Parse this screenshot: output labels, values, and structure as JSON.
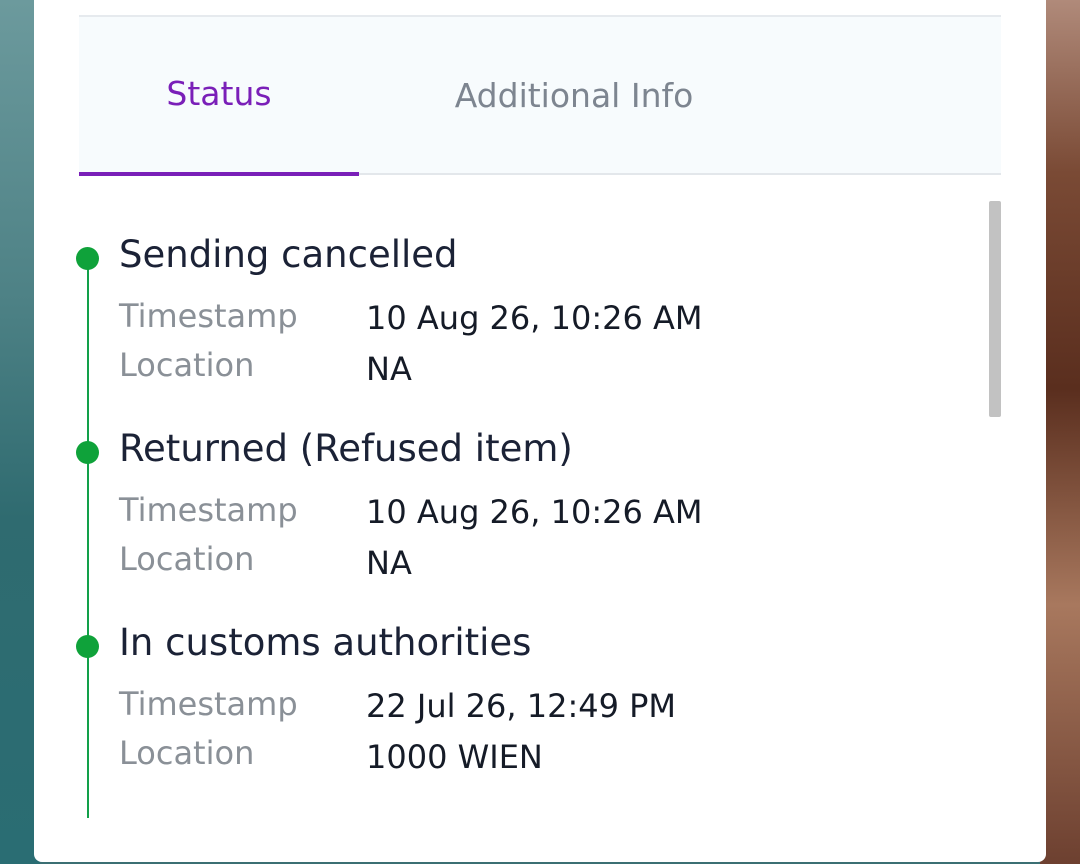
{
  "tabs": {
    "status_label": "Status",
    "info_label": "Additional Info",
    "active": "Status"
  },
  "events": [
    {
      "title": "Sending cancelled",
      "timestamp_label": "Timestamp",
      "timestamp_value": "10 Aug 26, 10:26 AM",
      "location_label": "Location",
      "location_value": "NA"
    },
    {
      "title": "Returned (Refused item)",
      "timestamp_label": "Timestamp",
      "timestamp_value": "10 Aug 26, 10:26 AM",
      "location_label": "Location",
      "location_value": "NA"
    },
    {
      "title": "In customs authorities",
      "timestamp_label": "Timestamp",
      "timestamp_value": "22 Jul 26, 12:49 PM",
      "location_label": "Location",
      "location_value": "1000 WIEN"
    }
  ],
  "colors": {
    "accent": "#7a1fb8",
    "timeline": "#0fa23a"
  }
}
